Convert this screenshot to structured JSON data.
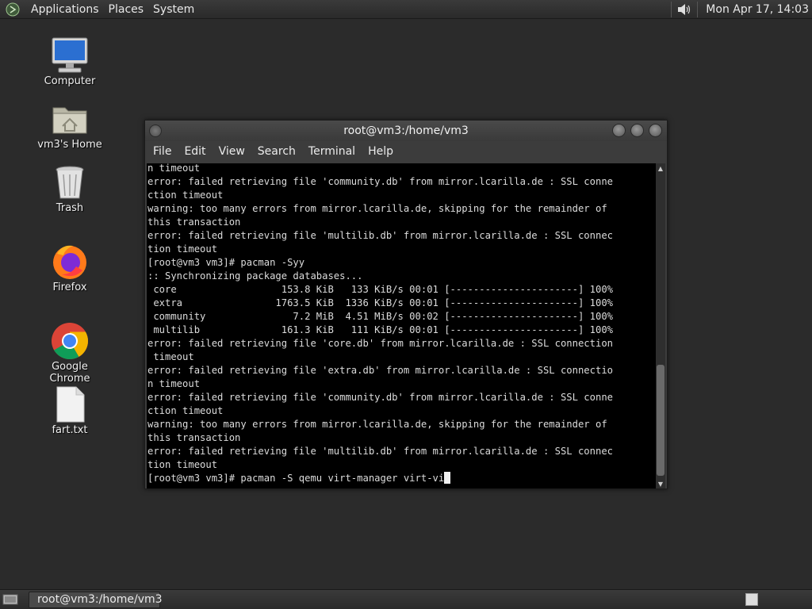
{
  "top_panel": {
    "menus": [
      "Applications",
      "Places",
      "System"
    ],
    "clock": "Mon Apr 17, 14:03"
  },
  "desktop_icons": [
    {
      "label": "Computer",
      "icon": "computer-icon"
    },
    {
      "label": "vm3's Home",
      "icon": "home-folder-icon"
    },
    {
      "label": "Trash",
      "icon": "trash-icon"
    },
    {
      "label": "Firefox",
      "icon": "firefox-icon"
    },
    {
      "label": "Google Chrome",
      "icon": "chrome-icon"
    },
    {
      "label": "fart.txt",
      "icon": "text-file-icon"
    }
  ],
  "terminal": {
    "title": "root@vm3:/home/vm3",
    "menu": [
      "File",
      "Edit",
      "View",
      "Search",
      "Terminal",
      "Help"
    ],
    "lines": [
      "n timeout",
      "error: failed retrieving file 'community.db' from mirror.lcarilla.de : SSL conne",
      "ction timeout",
      "warning: too many errors from mirror.lcarilla.de, skipping for the remainder of",
      "this transaction",
      "error: failed retrieving file 'multilib.db' from mirror.lcarilla.de : SSL connec",
      "tion timeout",
      "[root@vm3 vm3]# pacman -Syy",
      ":: Synchronizing package databases...",
      " core                  153.8 KiB   133 KiB/s 00:01 [----------------------] 100%",
      " extra                1763.5 KiB  1336 KiB/s 00:01 [----------------------] 100%",
      " community               7.2 MiB  4.51 MiB/s 00:02 [----------------------] 100%",
      " multilib              161.3 KiB   111 KiB/s 00:01 [----------------------] 100%",
      "error: failed retrieving file 'core.db' from mirror.lcarilla.de : SSL connection",
      " timeout",
      "error: failed retrieving file 'extra.db' from mirror.lcarilla.de : SSL connectio",
      "n timeout",
      "error: failed retrieving file 'community.db' from mirror.lcarilla.de : SSL conne",
      "ction timeout",
      "warning: too many errors from mirror.lcarilla.de, skipping for the remainder of",
      "this transaction",
      "error: failed retrieving file 'multilib.db' from mirror.lcarilla.de : SSL connec",
      "tion timeout"
    ],
    "prompt_line": "[root@vm3 vm3]# pacman -S qemu virt-manager virt-vi"
  },
  "bottom_panel": {
    "task_label": "root@vm3:/home/vm3"
  }
}
